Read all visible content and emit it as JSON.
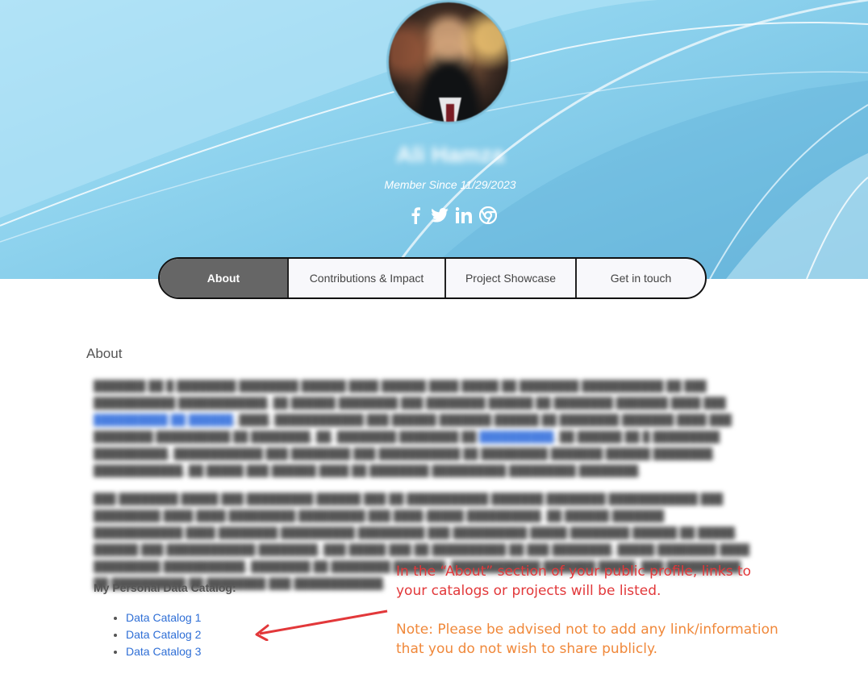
{
  "profile": {
    "name": "Ali Hamza",
    "member_since": "Member Since 11/29/2023",
    "social_icons": [
      "facebook-icon",
      "twitter-icon",
      "linkedin-icon",
      "chrome-icon"
    ]
  },
  "tabs": [
    {
      "label": "About",
      "active": true
    },
    {
      "label": "Contributions & Impact",
      "active": false
    },
    {
      "label": "Project Showcase",
      "active": false
    },
    {
      "label": "Get in touch",
      "active": false
    }
  ],
  "about": {
    "title": "About"
  },
  "catalog": {
    "title": "My Personal Data Catalog:",
    "items": [
      "Data Catalog 1",
      "Data Catalog 2",
      "Data Catalog 3"
    ]
  },
  "annotation": {
    "main": "In the “About” section of your public profile, links to your catalogs or projects will be listed.",
    "note": "Note: Please be advised not to add any link/information that you do not wish to share publicly."
  },
  "colors": {
    "active_tab": "#666666",
    "link": "#2f6fd6",
    "annotation_red": "#e2383a",
    "annotation_orange": "#f0883a"
  }
}
